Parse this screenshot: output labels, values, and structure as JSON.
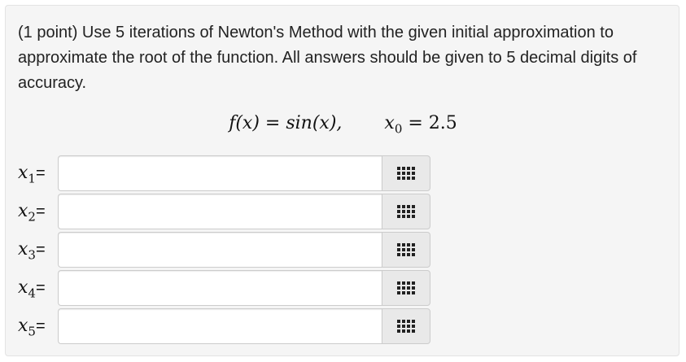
{
  "problem": {
    "text": "(1 point) Use 5 iterations of Newton's Method with the given initial approximation to approximate the root of the function. All answers should be given to 5 decimal digits of accuracy."
  },
  "formula": {
    "f_lhs": "f(x) = sin(x),",
    "x0_var": "x",
    "x0_sub": "0",
    "x0_rhs": " = 2.5"
  },
  "answers": [
    {
      "var": "x",
      "sub": "1",
      "eq": "=",
      "value": "",
      "icon": "grid-icon"
    },
    {
      "var": "x",
      "sub": "2",
      "eq": "=",
      "value": "",
      "icon": "grid-icon"
    },
    {
      "var": "x",
      "sub": "3",
      "eq": "=",
      "value": "",
      "icon": "grid-icon"
    },
    {
      "var": "x",
      "sub": "4",
      "eq": "=",
      "value": "",
      "icon": "grid-icon"
    },
    {
      "var": "x",
      "sub": "5",
      "eq": "=",
      "value": "",
      "icon": "grid-icon"
    }
  ],
  "colors": {
    "panel_bg": "#f5f5f5",
    "palette_button_bg": "#e9e9e9",
    "border": "#cccccc"
  }
}
